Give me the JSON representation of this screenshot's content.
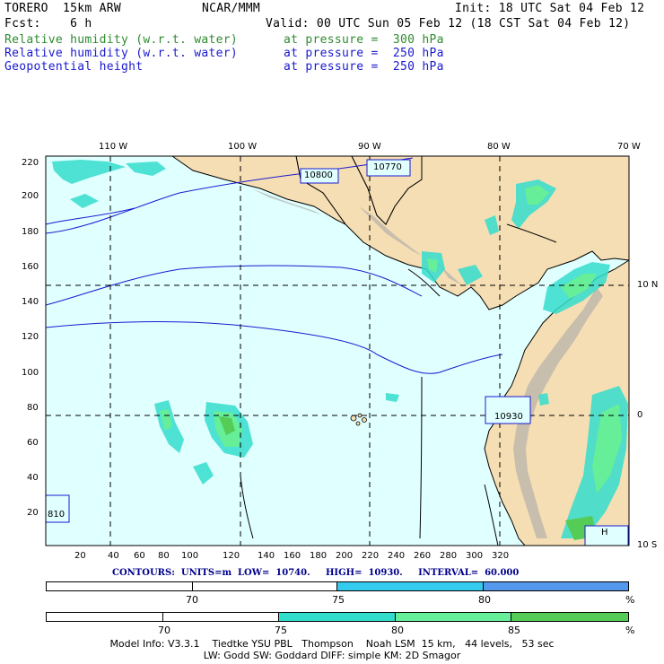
{
  "header": {
    "model": "TORERO  15km ARW",
    "center": "NCAR/MMM",
    "init": "Init: 18 UTC Sat 04 Feb 12",
    "fcst": "Fcst:    6 h",
    "valid": "Valid: 00 UTC Sun 05 Feb 12 (18 CST Sat 04 Feb 12)",
    "fields": [
      {
        "name": "Relative humidity (w.r.t. water)",
        "level": "at pressure =  300 hPa",
        "color": "#2e8b2e"
      },
      {
        "name": "Relative humidity (w.r.t. water)",
        "level": "at pressure =  250 hPa",
        "color": "#1a1ad0"
      },
      {
        "name": "Geopotential height",
        "level": "at pressure =  250 hPa",
        "color": "#1a1ad0"
      }
    ]
  },
  "map": {
    "lon_labels": [
      "110 W",
      "100 W",
      "90 W",
      "80 W",
      "70 W"
    ],
    "lat_labels": [
      "10 N",
      "0",
      "10 S"
    ],
    "y_ticks": [
      "220",
      "200",
      "180",
      "160",
      "140",
      "120",
      "100",
      "80",
      "60",
      "40",
      "20"
    ],
    "x_ticks": [
      "20",
      "40",
      "60",
      "80",
      "100",
      "120",
      "140",
      "160",
      "180",
      "200",
      "220",
      "240",
      "260",
      "280",
      "300",
      "320"
    ],
    "contour_labels": [
      "10800",
      "10770",
      "10930",
      "810",
      "H"
    ],
    "ocean_color": "#e0ffff",
    "land_color": "#f5deb3"
  },
  "contours_info": "CONTOURS:  UNITS=m  LOW=  10740.     HIGH=  10930.     INTERVAL=  60.000",
  "legend_bars": [
    {
      "ticks": [
        "70",
        "75",
        "80",
        "%"
      ],
      "colors": [
        "#ffffff",
        "#ffffff",
        "#33ccee",
        "#5599ee"
      ]
    },
    {
      "ticks": [
        "70",
        "75",
        "80",
        "85",
        "%"
      ],
      "colors": [
        "#ffffff",
        "#ffffff",
        "#33ddcc",
        "#66ee99",
        "#55cc55"
      ]
    }
  ],
  "footer": {
    "line1": "Model Info: V3.3.1    Tiedtke YSU PBL   Thompson    Noah LSM  15 km,   44 levels,   53 sec",
    "line2": "LW: Godd SW: Goddard DIFF: simple KM: 2D Smagor"
  }
}
